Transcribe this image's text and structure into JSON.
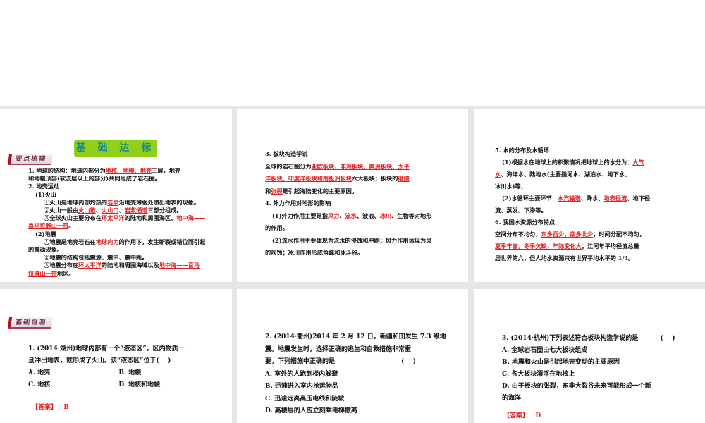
{
  "slides": [
    {
      "title": "基 础 达 标",
      "tag": "要点梳理",
      "lines": [
        [
          {
            "t": "1. 地球的结构：地球内部分为"
          },
          {
            "t": "地核、地幔、地壳",
            "red": true
          },
          {
            "t": "三层，地壳"
          }
        ],
        [
          {
            "t": "和地幔顶部(软流层以上的部分)共同组成了岩石圈。"
          }
        ],
        [
          {
            "t": "2. 地壳运动"
          }
        ],
        [
          {
            "t": "(1)火山"
          }
        ],
        [
          {
            "t": "①火山是地球内部灼热的"
          },
          {
            "t": "岩浆",
            "red": true
          },
          {
            "t": "沿地壳薄弱处喷出地表的现象。"
          }
        ],
        [
          {
            "t": "②火山一般由"
          },
          {
            "t": "火山锥",
            "red": true
          },
          {
            "t": "、"
          },
          {
            "t": "火山口",
            "red": true
          },
          {
            "t": "、"
          },
          {
            "t": "岩浆通道",
            "red": true
          },
          {
            "t": "三部分组成。"
          }
        ],
        [
          {
            "t": "③全球火山主要分布在"
          },
          {
            "t": "环太平洋",
            "red": true
          },
          {
            "t": "的陆地和周围海区、"
          },
          {
            "t": "地中海——",
            "red": true
          }
        ],
        [
          {
            "t": "喜马拉雅山一带",
            "red": true
          },
          {
            "t": "。"
          }
        ],
        [
          {
            "t": "(2)地震"
          }
        ],
        [
          {
            "t": "①地震是地壳岩石在"
          },
          {
            "t": "地球内力",
            "red": true
          },
          {
            "t": "的作用下，发生断裂或错位而引起"
          }
        ],
        [
          {
            "t": "的震动现象。"
          }
        ],
        [
          {
            "t": "②地震的结构包括震源、震中、震中距。"
          }
        ],
        [
          {
            "t": "③地震分布在"
          },
          {
            "t": "环太平洋",
            "red": true
          },
          {
            "t": "的陆地和周围海域以及"
          },
          {
            "t": "地中海——喜马",
            "red": true
          }
        ],
        [
          {
            "t": "拉雅山一带",
            "red": true
          },
          {
            "t": "地区。"
          }
        ]
      ]
    },
    {
      "lines": [
        [
          {
            "t": "3. 板块构造学说"
          }
        ],
        [
          {
            "t": "全球的岩石圈分为"
          },
          {
            "t": "亚欧板块、非洲板块、美洲板块、太平",
            "red": true
          }
        ],
        [
          {
            "t": "洋板块、印度洋板块和南极洲板块",
            "red": true
          },
          {
            "t": "六大板块；板块的"
          },
          {
            "t": "碰撞",
            "red": true
          }
        ],
        [
          {
            "t": "和"
          },
          {
            "t": "张裂",
            "red": true
          },
          {
            "t": "是引起海陆变化的主要原因。"
          }
        ],
        [
          {
            "t": "4. 外力作用对地形的影响"
          }
        ],
        [
          {
            "t": "(1)外力作用主要是指"
          },
          {
            "t": "风力",
            "red": true
          },
          {
            "t": "、"
          },
          {
            "t": "流水",
            "red": true
          },
          {
            "t": "、波浪、"
          },
          {
            "t": "冰川",
            "red": true
          },
          {
            "t": "、生物等对地形"
          }
        ],
        [
          {
            "t": "的作用。"
          }
        ],
        [
          {
            "t": "(2)流水作用主要体现为流水的侵蚀和冲刷；风力作用体现为风"
          }
        ],
        [
          {
            "t": "的吹蚀；冰川作用形成角峰和冰斗谷。"
          }
        ]
      ]
    },
    {
      "lines": [
        [
          {
            "t": "5. 水的分布及水循环"
          }
        ],
        [
          {
            "t": "(1)根据水在地球上的积聚情况把地球上的水分为："
          },
          {
            "t": "大气",
            "red": true
          }
        ],
        [
          {
            "t": "水",
            "red": true
          },
          {
            "t": "、海洋水、陆地水(主要指河水、湖泊水、地下水、"
          }
        ],
        [
          {
            "t": "冰川水)等；"
          }
        ],
        [
          {
            "t": "(2)水循环主要环节："
          },
          {
            "t": "水汽输送",
            "red": true
          },
          {
            "t": "、降水、"
          },
          {
            "t": "地表径流",
            "red": true
          },
          {
            "t": "、地下径"
          }
        ],
        [
          {
            "t": "流、蒸发、下渗等。"
          }
        ],
        [
          {
            "t": "6. 我国水资源分布特点"
          }
        ],
        [
          {
            "t": "空间分布不均匀，"
          },
          {
            "t": "东多西少，南多北少",
            "red": true
          },
          {
            "t": "；时间分配不均匀，"
          }
        ],
        [
          {
            "t": "夏季丰富，冬季欠缺，年际变化大",
            "red": true
          },
          {
            "t": "；江河年平均径流总量"
          }
        ],
        [
          {
            "t": "居世界第六，但人均水资源只有世界平均水平的 1/4。"
          }
        ]
      ]
    },
    {
      "tag": "基础自测",
      "lines": [
        [
          {
            "t": "1. (2014·湖州)地球内部有一个“液态区”，区内物质一"
          }
        ],
        [
          {
            "t": "旦冲出地表，就形成了火山。该“液态区”位于(    )"
          }
        ],
        [
          {
            "t": "A. 地壳                               B. 地幔"
          }
        ],
        [
          {
            "t": "C. 地核                               D. 地核和地幔"
          }
        ]
      ],
      "answer_label": "【答案】",
      "answer": "B"
    },
    {
      "lines": [
        [
          {
            "t": "2. (2014·衢州)2014 年 2 月 12 日，新疆和田发生 7.3 级地"
          }
        ],
        [
          {
            "t": "震。地震发生时，选择正确的逃生和自救措施非常重"
          }
        ],
        [
          {
            "t": "要，下列措施中正确的是                              (    )"
          }
        ],
        [
          {
            "t": "A. 室外的人跑到楼内躲避"
          }
        ],
        [
          {
            "t": "B. 迅速进入室内抢运物品"
          }
        ],
        [
          {
            "t": "C. 迅速远离高压电线和陡坡"
          }
        ],
        [
          {
            "t": "D. 高楼层的人应立刻乘电梯撤离"
          }
        ]
      ]
    },
    {
      "lines": [
        [
          {
            "t": "3. (2014·杭州)下列表述符合板块构造学说的是          (    )"
          }
        ],
        [
          {
            "t": "A. 全球岩石圈由七大板块组成"
          }
        ],
        [
          {
            "t": "B. 地震和火山是引起地壳变动的主要原因"
          }
        ],
        [
          {
            "t": "C. 各大板块漂浮在地核上"
          }
        ],
        [
          {
            "t": "D. 由于板块的张裂，东非大裂谷未来可能形成一个新"
          }
        ],
        [
          {
            "t": "的海洋"
          }
        ]
      ],
      "answer_label": "【答案】",
      "answer": "D"
    }
  ]
}
